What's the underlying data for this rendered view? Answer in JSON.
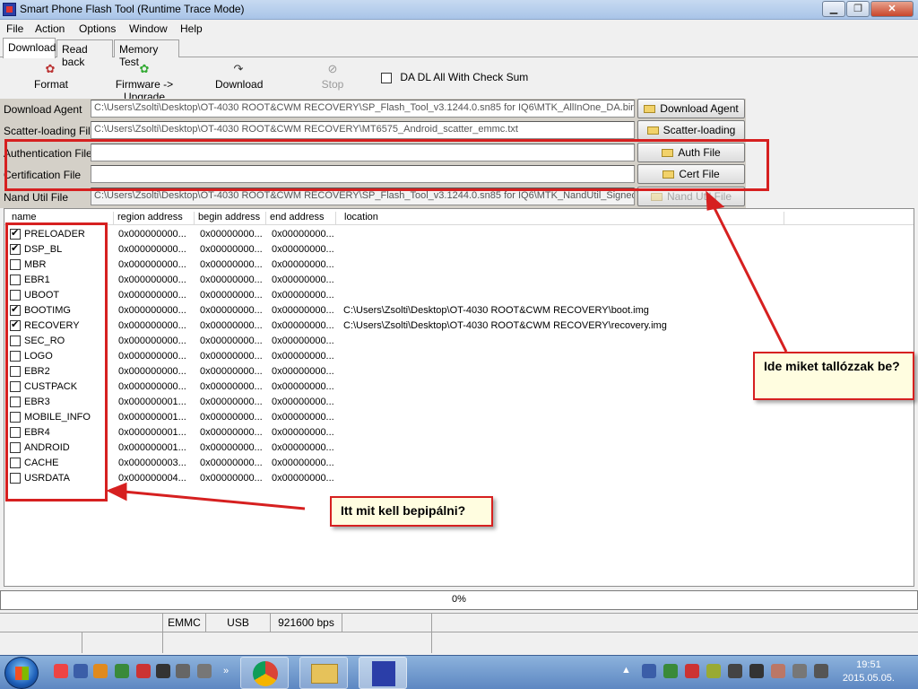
{
  "window": {
    "title": "Smart Phone Flash Tool (Runtime Trace Mode)",
    "min_glyph": "▁",
    "max_glyph": "❐",
    "close_glyph": "✕"
  },
  "menu": [
    "File",
    "Action",
    "Options",
    "Window",
    "Help"
  ],
  "tabs": [
    "Download",
    "Read back",
    "Memory Test"
  ],
  "toolbar": {
    "format": "Format",
    "firmware": "Firmware -> Upgrade",
    "download": "Download",
    "stop": "Stop",
    "da_dl_label": "DA DL All With Check Sum"
  },
  "files": {
    "download_agent": {
      "label": "Download Agent",
      "value": "C:\\Users\\Zsolti\\Desktop\\OT-4030 ROOT&CWM RECOVERY\\SP_Flash_Tool_v3.1244.0.sn85 for IQ6\\MTK_AllInOne_DA.bin",
      "button": "Download Agent"
    },
    "scatter": {
      "label": "Scatter-loading File",
      "value": "C:\\Users\\Zsolti\\Desktop\\OT-4030 ROOT&CWM RECOVERY\\MT6575_Android_scatter_emmc.txt",
      "button": "Scatter-loading"
    },
    "auth": {
      "label": "Authentication File",
      "value": "",
      "button": "Auth File"
    },
    "cert": {
      "label": "Certification File",
      "value": "",
      "button": "Cert File"
    },
    "nand": {
      "label": "Nand Util File",
      "value": "C:\\Users\\Zsolti\\Desktop\\OT-4030 ROOT&CWM RECOVERY\\SP_Flash_Tool_v3.1244.0.sn85 for IQ6\\MTK_NandUtil_Signed.",
      "button": "Nand Util File"
    }
  },
  "grid": {
    "columns": [
      "name",
      "region address",
      "begin address",
      "end address",
      "location"
    ],
    "rows": [
      {
        "checked": true,
        "name": "PRELOADER",
        "region": "0x000000000...",
        "begin": "0x00000000...",
        "end": "0x00000000...",
        "location": ""
      },
      {
        "checked": true,
        "name": "DSP_BL",
        "region": "0x000000000...",
        "begin": "0x00000000...",
        "end": "0x00000000...",
        "location": ""
      },
      {
        "checked": false,
        "name": "MBR",
        "region": "0x000000000...",
        "begin": "0x00000000...",
        "end": "0x00000000...",
        "location": ""
      },
      {
        "checked": false,
        "name": "EBR1",
        "region": "0x000000000...",
        "begin": "0x00000000...",
        "end": "0x00000000...",
        "location": ""
      },
      {
        "checked": false,
        "name": "UBOOT",
        "region": "0x000000000...",
        "begin": "0x00000000...",
        "end": "0x00000000...",
        "location": ""
      },
      {
        "checked": true,
        "name": "BOOTIMG",
        "region": "0x000000000...",
        "begin": "0x00000000...",
        "end": "0x00000000...",
        "location": "C:\\Users\\Zsolti\\Desktop\\OT-4030 ROOT&CWM RECOVERY\\boot.img"
      },
      {
        "checked": true,
        "name": "RECOVERY",
        "region": "0x000000000...",
        "begin": "0x00000000...",
        "end": "0x00000000...",
        "location": "C:\\Users\\Zsolti\\Desktop\\OT-4030 ROOT&CWM RECOVERY\\recovery.img"
      },
      {
        "checked": false,
        "name": "SEC_RO",
        "region": "0x000000000...",
        "begin": "0x00000000...",
        "end": "0x00000000...",
        "location": ""
      },
      {
        "checked": false,
        "name": "LOGO",
        "region": "0x000000000...",
        "begin": "0x00000000...",
        "end": "0x00000000...",
        "location": ""
      },
      {
        "checked": false,
        "name": "EBR2",
        "region": "0x000000000...",
        "begin": "0x00000000...",
        "end": "0x00000000...",
        "location": ""
      },
      {
        "checked": false,
        "name": "CUSTPACK",
        "region": "0x000000000...",
        "begin": "0x00000000...",
        "end": "0x00000000...",
        "location": ""
      },
      {
        "checked": false,
        "name": "EBR3",
        "region": "0x000000001...",
        "begin": "0x00000000...",
        "end": "0x00000000...",
        "location": ""
      },
      {
        "checked": false,
        "name": "MOBILE_INFO",
        "region": "0x000000001...",
        "begin": "0x00000000...",
        "end": "0x00000000...",
        "location": ""
      },
      {
        "checked": false,
        "name": "EBR4",
        "region": "0x000000001...",
        "begin": "0x00000000...",
        "end": "0x00000000...",
        "location": ""
      },
      {
        "checked": false,
        "name": "ANDROID",
        "region": "0x000000001...",
        "begin": "0x00000000...",
        "end": "0x00000000...",
        "location": ""
      },
      {
        "checked": false,
        "name": "CACHE",
        "region": "0x000000003...",
        "begin": "0x00000000...",
        "end": "0x00000000...",
        "location": ""
      },
      {
        "checked": false,
        "name": "USRDATA",
        "region": "0x000000004...",
        "begin": "0x00000000...",
        "end": "0x00000000...",
        "location": ""
      }
    ]
  },
  "progress": {
    "percent_text": "0%"
  },
  "status": {
    "storage": "EMMC",
    "connection": "USB",
    "baud": "921600 bps"
  },
  "annotations": {
    "callout_right": "Ide miket tallózzak be?",
    "callout_bottom": "Itt mit kell bepipálni?",
    "color": "#d62020"
  },
  "taskbar": {
    "time": "19:51",
    "date": "2015.05.05."
  }
}
